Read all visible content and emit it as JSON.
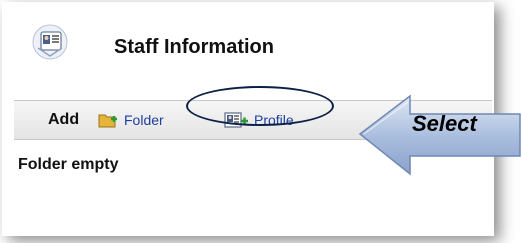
{
  "header": {
    "title": "Staff Information",
    "icon": "staff-directory-icon"
  },
  "toolbar": {
    "add_label": "Add",
    "folder_label": "Folder",
    "folder_icon": "folder-add-icon",
    "profile_label": "Profile",
    "profile_icon": "profile-add-icon"
  },
  "content": {
    "empty_message": "Folder empty"
  },
  "annotation": {
    "callout_text": "Select",
    "arrow_color": "#9fb3d6",
    "ellipse_color": "#0b1f47"
  },
  "colors": {
    "link": "#1e3fa0",
    "toolbar_bg": "#ececec"
  }
}
